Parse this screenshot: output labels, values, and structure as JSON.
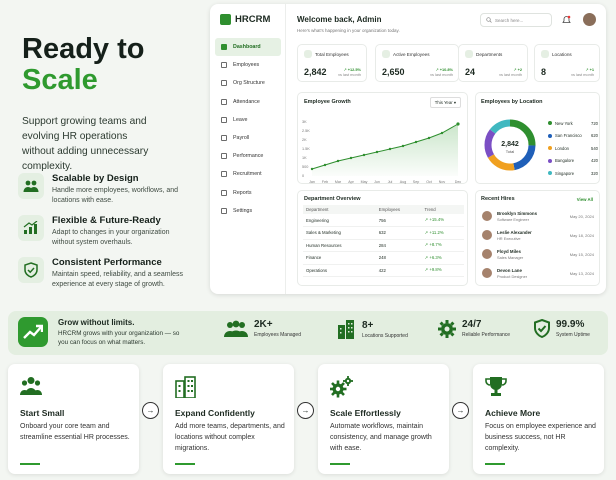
{
  "hero": {
    "title_line1": "Ready to",
    "title_line2": "Scale",
    "subtitle": "Support growing teams and evolving HR operations without adding unnecessary complexity.",
    "features": [
      {
        "icon": "team-icon",
        "title": "Scalable by Design",
        "desc": "Handle more employees, workflows, and locations with ease."
      },
      {
        "icon": "growth-chart-icon",
        "title": "Flexible & Future-Ready",
        "desc": "Adapt to changes in your organization without system overhauls."
      },
      {
        "icon": "shield-check-icon",
        "title": "Consistent Performance",
        "desc": "Maintain speed, reliability, and a seamless experience at every stage of growth."
      }
    ]
  },
  "dashboard": {
    "brand": "HRCRM",
    "nav": [
      "Dashboard",
      "Employees",
      "Org Structure",
      "Attendance",
      "Leave",
      "Payroll",
      "Performance",
      "Recruitment",
      "Reports",
      "Settings"
    ],
    "welcome": "Welcome back, Admin",
    "welcome_sub": "Here's what's happening in your organization today.",
    "search_placeholder": "Search here...",
    "stats": [
      {
        "label": "Total Employees",
        "value": "2,842",
        "change": "+12.5%",
        "period": "vs last month"
      },
      {
        "label": "Active Employees",
        "value": "2,650",
        "change": "+10.8%",
        "period": "vs last month"
      },
      {
        "label": "Departments",
        "value": "24",
        "change": "+2",
        "period": "vs last month"
      },
      {
        "label": "Locations",
        "value": "8",
        "change": "+1",
        "period": "vs last month"
      }
    ],
    "growth": {
      "title": "Employee Growth",
      "range": "This Year",
      "yticks": [
        "3K",
        "2.5K",
        "2K",
        "1.5K",
        "1K",
        "500",
        "0"
      ],
      "months": [
        "Jan",
        "Feb",
        "Mar",
        "Apr",
        "May",
        "Jun",
        "Jul",
        "Aug",
        "Sep",
        "Oct",
        "Nov",
        "Dec"
      ]
    },
    "location": {
      "title": "Employees by Location",
      "total": "2,842",
      "total_label": "Total",
      "items": [
        {
          "name": "New York",
          "value": "720",
          "color": "#2f8f2f"
        },
        {
          "name": "San Francisco",
          "value": "620",
          "color": "#1f5fb8"
        },
        {
          "name": "London",
          "value": "540",
          "color": "#f0a020"
        },
        {
          "name": "Bangalore",
          "value": "420",
          "color": "#7b4fc4"
        },
        {
          "name": "Singapore",
          "value": "320",
          "color": "#40b8c0"
        }
      ]
    },
    "departments": {
      "title": "Department Overview",
      "headers": [
        "Department",
        "Employees",
        "Trend"
      ],
      "rows": [
        [
          "Engineering",
          "756",
          "+15.4%"
        ],
        [
          "Sales & Marketing",
          "632",
          "+11.2%"
        ],
        [
          "Human Resources",
          "284",
          "+8.7%"
        ],
        [
          "Finance",
          "248",
          "+6.3%"
        ],
        [
          "Operations",
          "422",
          "+9.8%"
        ]
      ]
    },
    "hires": {
      "title": "Recent Hires",
      "view_all": "View All",
      "items": [
        {
          "name": "Brooklyn Simmons",
          "role": "Software Engineer",
          "date": "May 20, 2024"
        },
        {
          "name": "Leslie Alexander",
          "role": "HR Executive",
          "date": "May 18, 2024"
        },
        {
          "name": "Floyd Miles",
          "role": "Sales Manager",
          "date": "May 15, 2024"
        },
        {
          "name": "Devon Lane",
          "role": "Product Designer",
          "date": "May 13, 2024"
        }
      ]
    }
  },
  "banner": {
    "title": "Grow without limits.",
    "subtitle": "HRCRM grows with your organization — so you can focus on what matters.",
    "stats": [
      {
        "icon": "people-icon",
        "value": "2K+",
        "caption": "Employees Managed"
      },
      {
        "icon": "buildings-icon",
        "value": "8+",
        "caption": "Locations Supported"
      },
      {
        "icon": "gear-icon",
        "value": "24/7",
        "caption": "Reliable Performance"
      },
      {
        "icon": "shield-check-icon",
        "value": "99.9%",
        "caption": "System Uptime"
      }
    ]
  },
  "steps": [
    {
      "icon": "people-icon",
      "title": "Start Small",
      "desc": "Onboard your core team and streamline essential HR processes."
    },
    {
      "icon": "buildings-icon",
      "title": "Expand Confidently",
      "desc": "Add more teams, departments, and locations without complex migrations."
    },
    {
      "icon": "gears-icon",
      "title": "Scale Effortlessly",
      "desc": "Automate workflows, maintain consistency, and manage growth with ease."
    },
    {
      "icon": "trophy-icon",
      "title": "Achieve More",
      "desc": "Focus on employee experience and business success, not HR complexity."
    }
  ],
  "colors": {
    "brand": "#2f9a2f",
    "brand_dark": "#226e22",
    "banner_bg": "#e3eee0"
  }
}
